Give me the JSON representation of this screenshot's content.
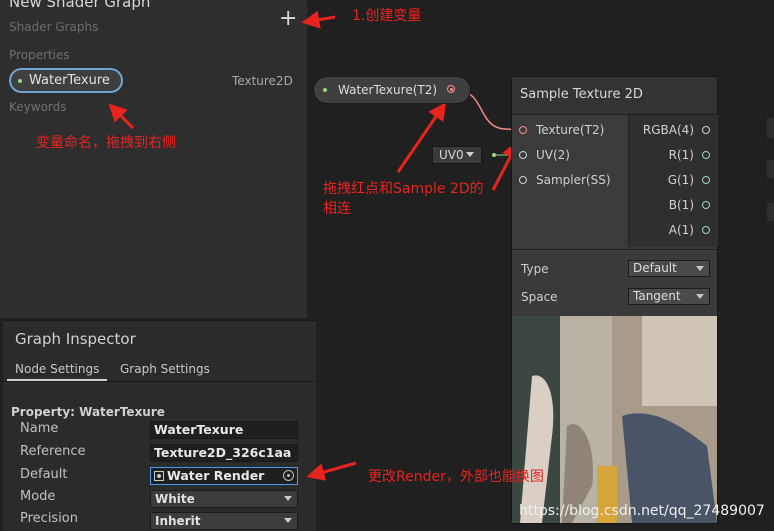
{
  "blackboard": {
    "title": "New Shader Graph",
    "subtitle": "Shader Graphs",
    "add_icon": "+",
    "properties_label": "Properties",
    "property": {
      "name": "WaterTexure",
      "type": "Texture2D"
    },
    "keywords_label": "Keywords"
  },
  "inspector": {
    "title": "Graph Inspector",
    "tabs": [
      "Node Settings",
      "Graph Settings"
    ],
    "property_header": "Property: WaterTexure",
    "fields": {
      "name": {
        "label": "Name",
        "value": "WaterTexure"
      },
      "reference": {
        "label": "Reference",
        "value": "Texture2D_326c1aa"
      },
      "default": {
        "label": "Default",
        "value": "Water Render",
        "icon": "render-texture-icon"
      },
      "mode": {
        "label": "Mode",
        "value": "White"
      },
      "precision": {
        "label": "Precision",
        "value": "Inherit"
      }
    }
  },
  "graph": {
    "property_node": {
      "label": "WaterTexure(T2)"
    },
    "uv_node": {
      "label": "UV0"
    },
    "sample_node": {
      "title": "Sample Texture 2D",
      "inputs": [
        "Texture(T2)",
        "UV(2)",
        "Sampler(SS)"
      ],
      "outputs": [
        "RGBA(4)",
        "R(1)",
        "G(1)",
        "B(1)",
        "A(1)"
      ],
      "type": {
        "label": "Type",
        "value": "Default"
      },
      "space": {
        "label": "Space",
        "value": "Tangent"
      }
    }
  },
  "annotations": {
    "create_var": "1.创建变量",
    "rename_drag": "变量命名，拖拽到右侧",
    "connect_line1": "拖拽红点和Sample 2D的",
    "connect_line2": "相连",
    "change_render": "更改Render，外部也能换图"
  },
  "watermark": "https://blog.csdn.net/qq_27489007",
  "colors": {
    "annotation": "#e8231e",
    "selection": "#6fa5d2",
    "connection": "#ff8a8a",
    "vector_port": "#9dd67a"
  }
}
